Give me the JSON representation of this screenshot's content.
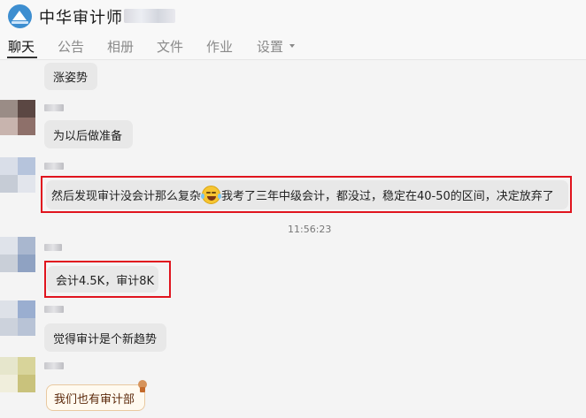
{
  "header": {
    "group_title": "中华审计师",
    "tabs": [
      {
        "label": "聊天",
        "active": true
      },
      {
        "label": "公告",
        "active": false
      },
      {
        "label": "相册",
        "active": false
      },
      {
        "label": "文件",
        "active": false
      },
      {
        "label": "作业",
        "active": false
      },
      {
        "label": "设置",
        "active": false,
        "has_dropdown": true
      }
    ]
  },
  "chat": {
    "messages": [
      {
        "text": "涨姿势"
      },
      {
        "text": "为以后做准备"
      },
      {
        "text_before_emoji": "然后发现审计没会计那么复杂",
        "emoji": "laughing-tears-emoji",
        "text_after_emoji": "我考了三年中级会计，都没过，稳定在40-50的区间，决定放弃了",
        "highlighted": true
      },
      {
        "text": "会计4.5K，审计8K",
        "highlighted": true
      },
      {
        "text": "觉得审计是个新趋势"
      },
      {
        "text": "我们也有审计部",
        "style": "gift"
      }
    ],
    "timestamp": "11:56:23"
  },
  "colors": {
    "highlight_border": "#e0141e",
    "bubble_bg": "#e8e8e8",
    "logo_blue": "#3d8ed0"
  }
}
